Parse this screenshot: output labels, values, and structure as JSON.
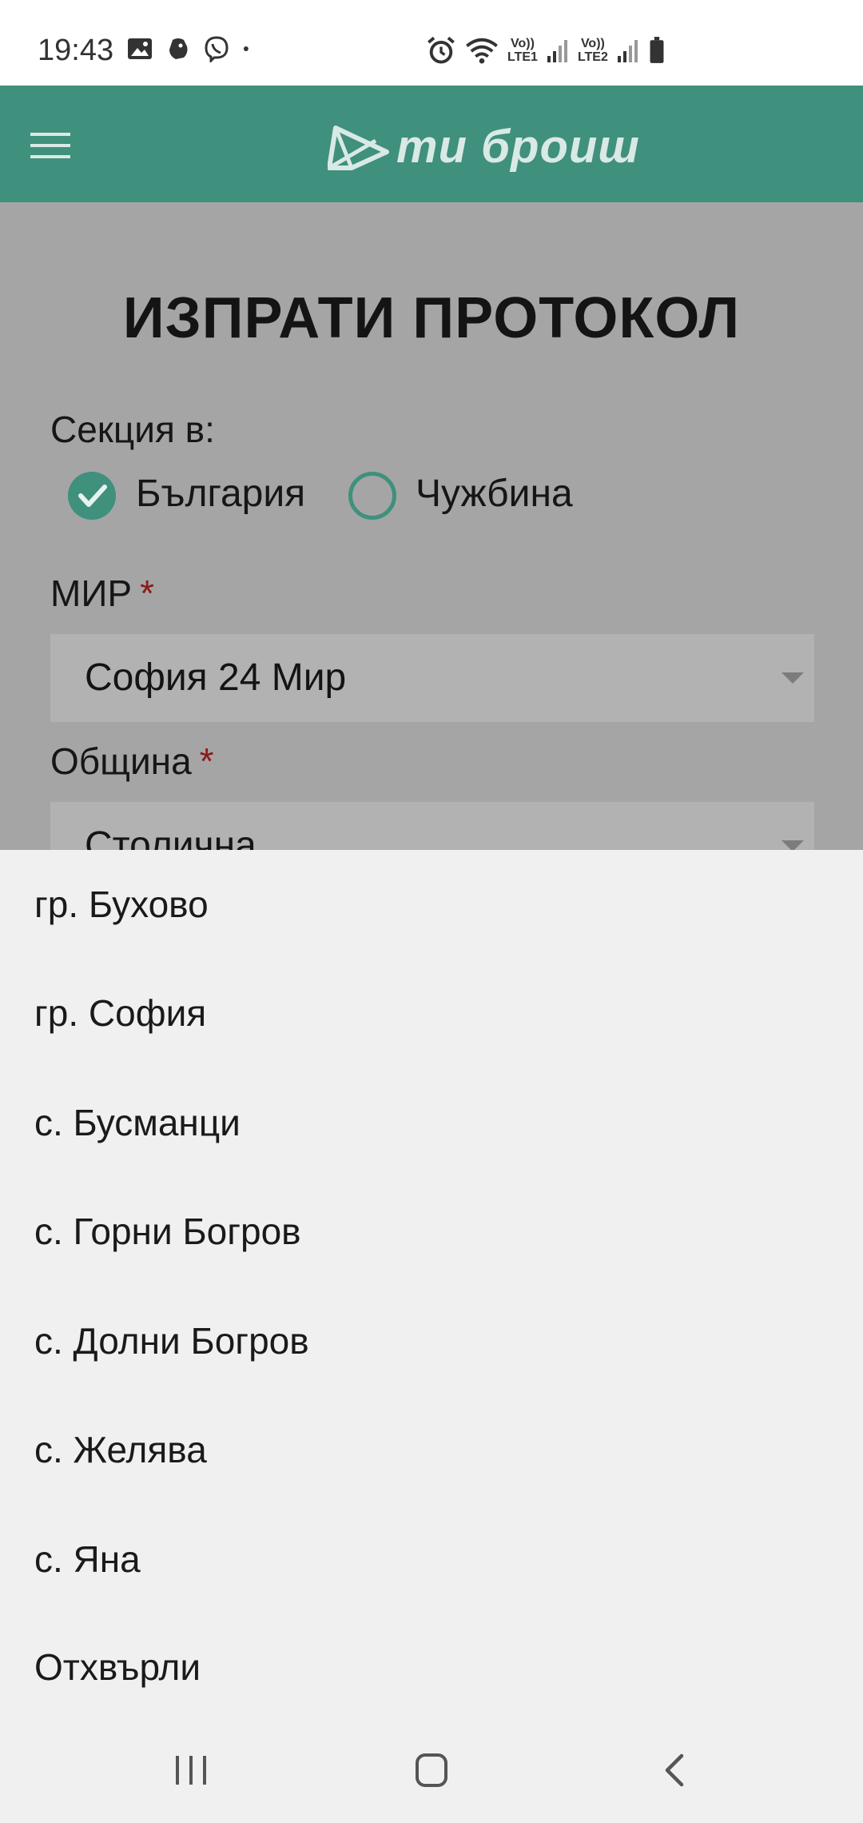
{
  "status_bar": {
    "time": "19:43",
    "icons_left": [
      "image-icon",
      "premier-league-icon",
      "viber-icon",
      "dot-icon"
    ],
    "icons_right": [
      "alarm-icon",
      "wifi-icon",
      "signal-lte1-icon",
      "signal-lte2-icon",
      "battery-icon"
    ],
    "sim1_label_top": "Vo))",
    "sim1_label_bottom": "LTE1",
    "sim2_label_top": "Vo))",
    "sim2_label_bottom": "LTE2"
  },
  "app_bar": {
    "menu_icon": "hamburger-menu-icon",
    "logo_text": "ти броиш",
    "background_color": "#3f907d"
  },
  "form": {
    "title": "ИЗПРАТИ ПРОТОКОЛ",
    "section_label": "Секция в:",
    "radio_options": [
      {
        "label": "България",
        "checked": true
      },
      {
        "label": "Чужбина",
        "checked": false
      }
    ],
    "mir": {
      "label": "МИР",
      "required_mark": "*",
      "value": "София 24 Мир"
    },
    "municipality": {
      "label": "Община",
      "required_mark": "*",
      "value": "Столична"
    }
  },
  "dropdown": {
    "items": [
      "гр. Бухово",
      "гр. София",
      "с. Бусманци",
      "с. Горни Богров",
      "с. Долни Богров",
      "с. Желява",
      "с. Яна",
      "Отхвърли"
    ]
  },
  "nav_bar": {
    "buttons": [
      "recent-apps-icon",
      "home-icon",
      "back-icon"
    ]
  }
}
